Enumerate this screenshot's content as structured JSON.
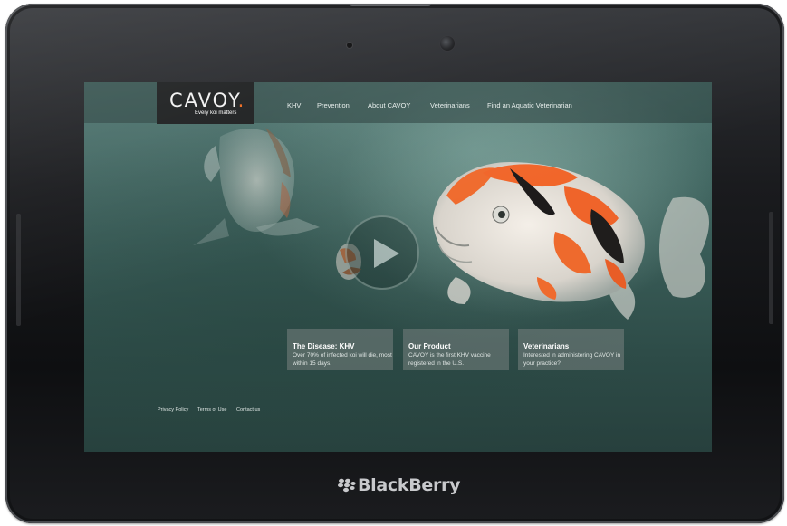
{
  "brand": {
    "logo_text": "CAVOY",
    "logo_dot": ".",
    "tagline": "Every koi matters",
    "accent_color": "#ef6a1e"
  },
  "nav": {
    "items": [
      {
        "label": "KHV"
      },
      {
        "label": "Prevention"
      },
      {
        "label": "About CAVOY"
      },
      {
        "label": "Veterinarians"
      },
      {
        "label": "Find an Aquatic Veterinarian"
      }
    ]
  },
  "hero": {
    "play_icon": "play-icon"
  },
  "cards": [
    {
      "title": "The Disease: KHV",
      "body": "Over 70% of infected koi will die, most within 15 days."
    },
    {
      "title": "Our Product",
      "body": "CAVOY is the first KHV vaccine registered in the U.S."
    },
    {
      "title": "Veterinarians",
      "body": "Interested in administering CAVOY in your practice?"
    }
  ],
  "footer": {
    "links": [
      {
        "label": "Privacy Policy"
      },
      {
        "label": "Terms of Use"
      },
      {
        "label": "Contact us"
      }
    ]
  },
  "device": {
    "brand_label": "BlackBerry"
  }
}
